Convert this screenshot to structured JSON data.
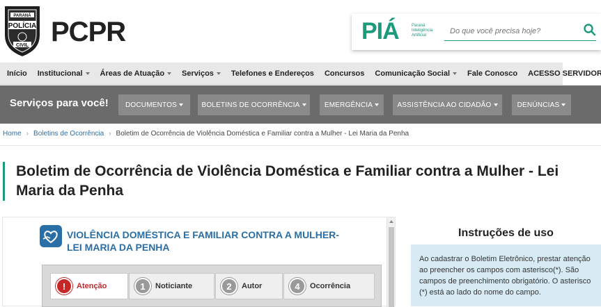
{
  "header": {
    "brand": "PCPR",
    "badge_text_top": "PARANÁ",
    "badge_text_main": "POLÍCIA",
    "badge_text_bottom": "CIVIL",
    "pia": {
      "logo": "PIÁ",
      "subtitle": "Paraná Inteligência Artificial",
      "search_placeholder": "Do que você precisa hoje?",
      "accent": "#1b9a7c"
    }
  },
  "nav": {
    "items": [
      {
        "label": "Início",
        "dropdown": false
      },
      {
        "label": "Institucional",
        "dropdown": true
      },
      {
        "label": "Áreas de Atuação",
        "dropdown": true
      },
      {
        "label": "Serviços",
        "dropdown": true
      },
      {
        "label": "Telefones e Endereços",
        "dropdown": false
      },
      {
        "label": "Concursos",
        "dropdown": false
      },
      {
        "label": "Comunicação Social",
        "dropdown": true
      },
      {
        "label": "Fale Conosco",
        "dropdown": false
      },
      {
        "label": "ACESSO SERVIDOR",
        "dropdown": false
      }
    ]
  },
  "services": {
    "title": "Serviços para você!",
    "buttons": [
      "DOCUMENTOS",
      "BOLETINS DE OCORRÊNCIA",
      "EMERGÊNCIA",
      "ASSISTÊNCIA AO CIDADÃO",
      "DENÚNCIAS"
    ]
  },
  "breadcrumb": {
    "home": "Home",
    "section": "Boletins de Ocorrência",
    "current": "Boletim de Ocorrência de Violência Doméstica e Familiar contra a Mulher - Lei Maria da Penha"
  },
  "page": {
    "title": "Boletim de Ocorrência de Violência Doméstica e Familiar contra a Mulher - Lei Maria da Penha"
  },
  "form": {
    "title_line1": "VIOLÊNCIA DOMÉSTICA E FAMILIAR CONTRA A MULHER-",
    "title_line2": "LEI MARIA DA PENHA",
    "steps": [
      {
        "num": "!",
        "label": "Atenção",
        "active": true
      },
      {
        "num": "1",
        "label": "Noticiante",
        "active": false
      },
      {
        "num": "2",
        "label": "Autor",
        "active": false
      },
      {
        "num": "4",
        "label": "Ocorrência",
        "active": false
      }
    ]
  },
  "instructions": {
    "title": "Instruções de uso",
    "text": "Ao cadastrar o Boletim Eletrônico, prestar atenção ao preencher os campos com asterisco(*). São campos de preenchimento obrigatório. O asterisco (*) está ao lado do nome do campo."
  },
  "colors": {
    "services_bg": "#6b6b6b",
    "services_btn": "#8a8a8a",
    "link": "#2a6ea6",
    "title_accent": "#1b9a7c",
    "alert": "#c62828",
    "instructions_bg": "#d7ebf5"
  }
}
